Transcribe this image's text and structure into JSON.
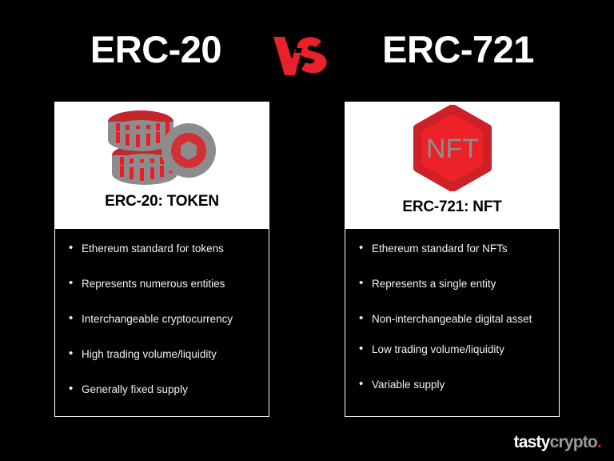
{
  "background_color": "#000000",
  "header": {
    "left_title": "ERC-20",
    "right_title": "ERC-721",
    "vs_label": "VS",
    "vs_color": "#E8212B"
  },
  "cards": [
    {
      "id": "erc20",
      "icon_name": "coin-stack-icon",
      "title": "ERC-20: TOKEN",
      "bullets": [
        "Ethereum standard for tokens",
        "Represents numerous entities",
        "Interchangeable cryptocurrency",
        "High trading volume/liquidity",
        "Generally fixed supply"
      ]
    },
    {
      "id": "erc721",
      "icon_name": "nft-hexagon-icon",
      "icon_text": "NFT",
      "title": "ERC-721: NFT",
      "bullets": [
        "Ethereum standard for NFTs",
        "Represents a single entity",
        "Non-interchangeable digital asset",
        "Low trading volume/liquidity",
        "Variable supply"
      ]
    }
  ],
  "logo": {
    "part1": "tasty",
    "part2": "crypto",
    "dot": ".",
    "accent_color": "#d9232e"
  },
  "colors": {
    "red": "#E8212B",
    "dark_red": "#C1272D",
    "gray": "#8C8C8C",
    "white": "#FFFFFF",
    "black": "#000000"
  }
}
